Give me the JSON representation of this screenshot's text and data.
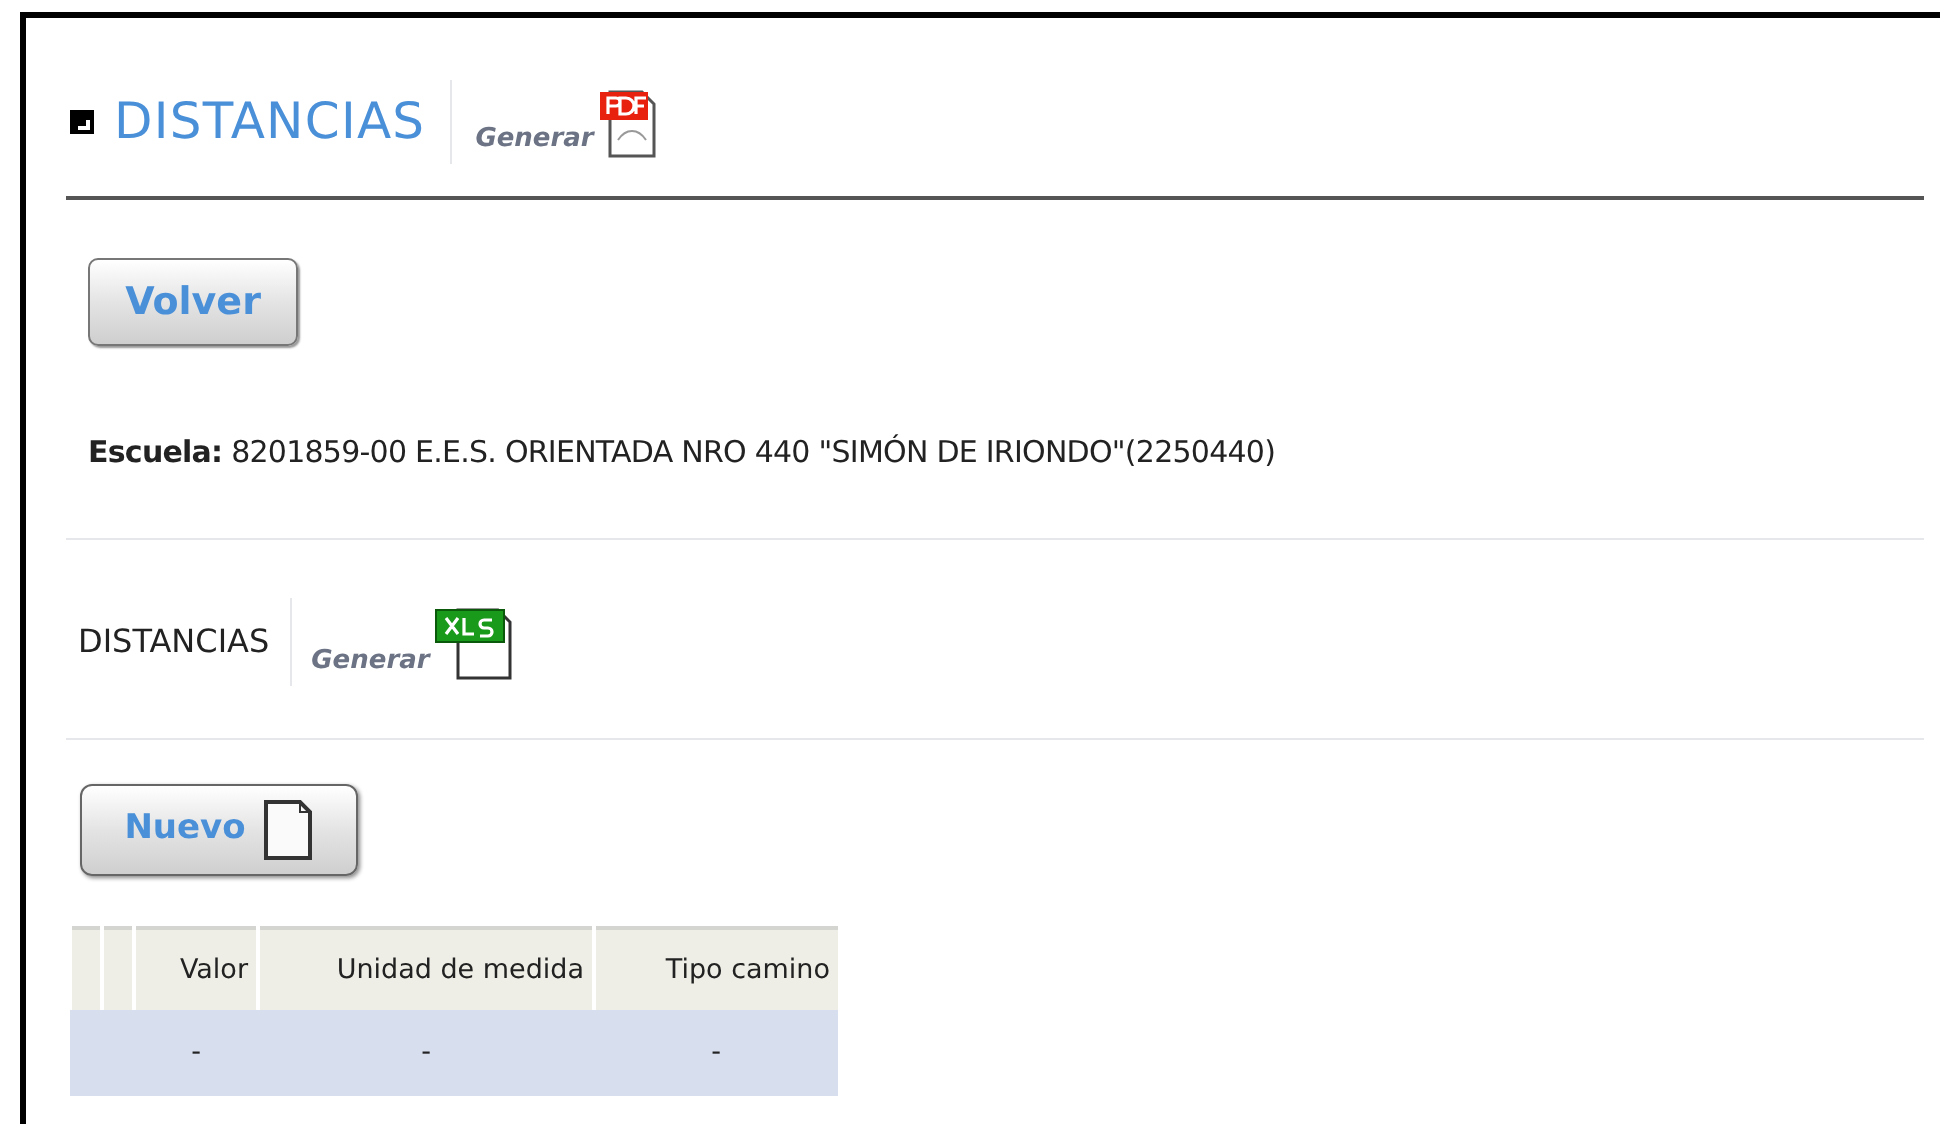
{
  "header": {
    "title": "DISTANCIAS",
    "action": "Generar"
  },
  "back_button": "Volver",
  "school": "**Escuela:** 8201859-00 E.E.S. ORIENTADA NRO 440 \"SIMÓN DE IRIONDO\"(2250440)",
  "section": {
    "title": "DISTANCIAS",
    "action": "Generar"
  },
  "new_button": "Nuevo",
  "table": {
    "columns": [
      "Valor",
      "Unidad de medida",
      "Tipo camino"
    ],
    "rows": [
      [
        "-",
        "-",
        "-"
      ]
    ]
  }
}
